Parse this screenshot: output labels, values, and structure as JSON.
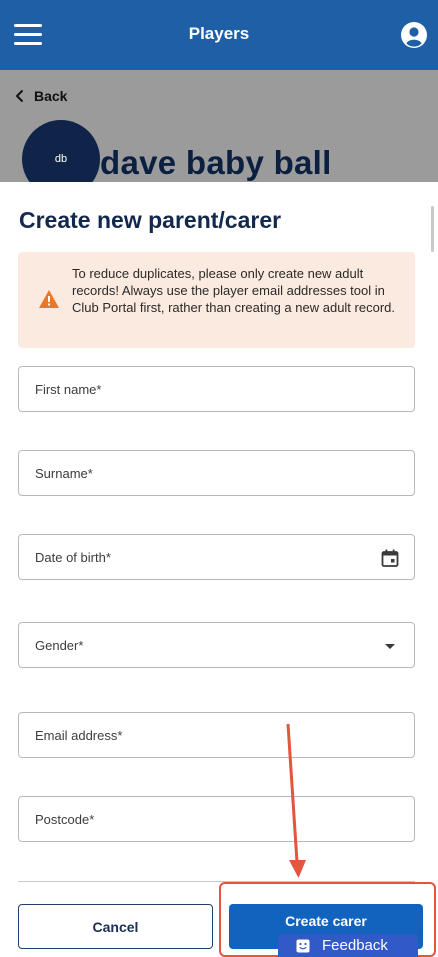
{
  "header": {
    "title": "Players"
  },
  "page": {
    "back_label": "Back",
    "avatar_initials": "db",
    "player_name": "dave baby ball"
  },
  "sheet": {
    "title": "Create new parent/carer",
    "warning": "To reduce duplicates, please only create new adult records! Always use the player email addresses tool in Club Portal first, rather than creating a new adult record."
  },
  "form": {
    "first_name": "First name*",
    "surname": "Surname*",
    "date_of_birth": "Date of birth*",
    "gender": "Gender*",
    "email": "Email address*",
    "postcode": "Postcode*"
  },
  "actions": {
    "cancel": "Cancel",
    "create": "Create carer"
  },
  "feedback": {
    "label": "Feedback"
  },
  "colors": {
    "header": "#1f5fa6",
    "primary": "#1163bd",
    "warning_bg": "#fbeae0",
    "warning_icon": "#e8782b",
    "annotation": "#e2553f"
  },
  "icons": [
    "menu-icon",
    "account-icon",
    "chevron-left-icon",
    "warning-icon",
    "calendar-icon",
    "chevron-down-icon",
    "feedback-icon",
    "annotation-arrow"
  ]
}
